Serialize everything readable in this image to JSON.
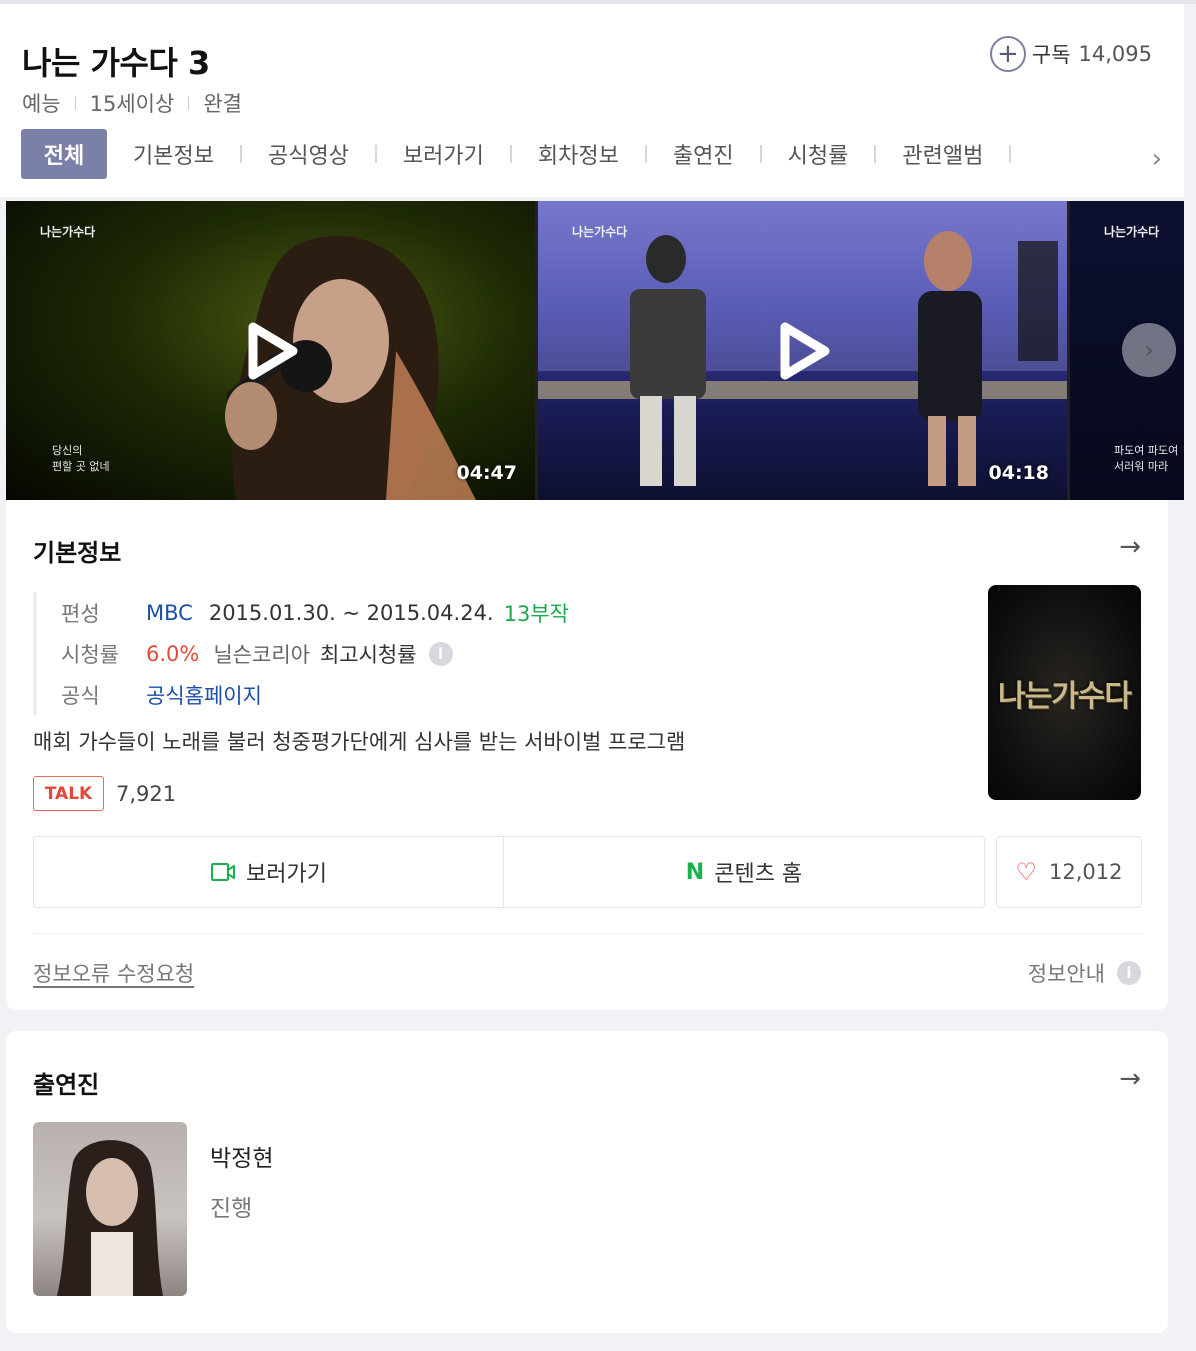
{
  "header": {
    "title": "나는 가수다 3",
    "meta": [
      "예능",
      "15세이상",
      "완결"
    ],
    "subscribe_label": "구독",
    "subscribe_count": "14,095"
  },
  "tabs": [
    "전체",
    "기본정보",
    "공식영상",
    "보러가기",
    "회차정보",
    "출연진",
    "시청률",
    "관련앨범"
  ],
  "videos": [
    {
      "logo": "나는가수다",
      "caption_line1": "당신의",
      "caption_line2": "편할 곳 없네",
      "duration": "04:47"
    },
    {
      "logo": "나는가수다",
      "caption_line1": "",
      "caption_line2": "",
      "duration": "04:18"
    },
    {
      "logo": "나는가수다",
      "caption_line1": "파도여 파도여",
      "caption_line2": "서러워 마라",
      "duration": ""
    }
  ],
  "basic_info": {
    "section_title": "기본정보",
    "broadcast_label": "편성",
    "broadcaster": "MBC",
    "period": "2015.01.30. ~ 2015.04.24.",
    "episodes": "13부작",
    "rating_label": "시청률",
    "rating_value": "6.0%",
    "rating_source": "닐슨코리아",
    "rating_note": "최고시청률",
    "official_label": "공식",
    "official_link": "공식홈페이지",
    "description": "매회 가수들이 노래를 불러 청중평가단에게 심사를 받는 서바이벌 프로그램",
    "talk_badge": "TALK",
    "talk_count": "7,921",
    "poster_logo": "나는가수다",
    "watch_button": "보러가기",
    "content_home_logo": "N",
    "content_home_button": "콘텐츠 홈",
    "like_count": "12,012",
    "report_link": "정보오류 수정요청",
    "guide_label": "정보안내"
  },
  "cast": {
    "section_title": "출연진",
    "members": [
      {
        "name": "박정현",
        "role": "진행"
      }
    ]
  },
  "colors": {
    "tab_active": "#7a80a8",
    "link_blue": "#1c4fa8",
    "episodes_green": "#1ba94c",
    "rating_red": "#e24a3c",
    "naver_green": "#19b34b"
  }
}
